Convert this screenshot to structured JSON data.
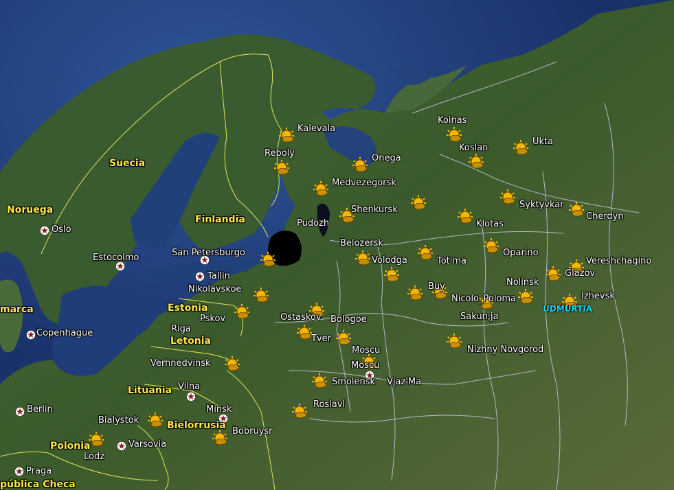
{
  "colors": {
    "sea": "#1f3f7a",
    "land": "#3c5a2a",
    "border": "#e6e65a",
    "region": "#c8c8e6",
    "icon": "#f5b800",
    "star": "#8a1a1a"
  },
  "countries": [
    {
      "id": "noruega",
      "label": "Noruega"
    },
    {
      "id": "suecia",
      "label": "Suecia"
    },
    {
      "id": "finlandia",
      "label": "Finlandia"
    },
    {
      "id": "estonia",
      "label": "Estonia"
    },
    {
      "id": "letonia",
      "label": "Letonia"
    },
    {
      "id": "lituania",
      "label": "Lituania"
    },
    {
      "id": "bielorrusia",
      "label": "Bielorrusia"
    },
    {
      "id": "polonia",
      "label": "Polonia"
    },
    {
      "id": "dinamarca",
      "label": "marca"
    },
    {
      "id": "chequia",
      "label": "pública Checa"
    }
  ],
  "region": {
    "label": "UDMURTIA"
  },
  "capitals": [
    {
      "id": "oslo",
      "label": "Oslo"
    },
    {
      "id": "estocolmo",
      "label": "Estocolmo"
    },
    {
      "id": "tallin",
      "label": "Tallin"
    },
    {
      "id": "copenhague",
      "label": "Copenhague"
    },
    {
      "id": "riga",
      "label": "Riga"
    },
    {
      "id": "vilna",
      "label": "Vilna"
    },
    {
      "id": "minsk",
      "label": "Minsk"
    },
    {
      "id": "berlin",
      "label": "Berlin"
    },
    {
      "id": "varsovia",
      "label": "Varsovia"
    },
    {
      "id": "praga",
      "label": "Praga"
    },
    {
      "id": "san-petersburgo",
      "label": "San Petersburgo"
    },
    {
      "id": "moscu",
      "label": "Moscu"
    }
  ],
  "stations": [
    {
      "id": "kalevala",
      "label": "Kalevala"
    },
    {
      "id": "reboly",
      "label": "Reboly"
    },
    {
      "id": "onega",
      "label": "Onega"
    },
    {
      "id": "medvezegorsk",
      "label": "Medvezegorsk"
    },
    {
      "id": "shenkursk",
      "label": "Shenkursk"
    },
    {
      "id": "pudozh",
      "label": "Pudozh"
    },
    {
      "id": "belozersk",
      "label": "Belozersk"
    },
    {
      "id": "volodga",
      "label": "Volodga"
    },
    {
      "id": "totma",
      "label": "Tot'ma"
    },
    {
      "id": "koinas",
      "label": "Koinas"
    },
    {
      "id": "koslan",
      "label": "Koslan"
    },
    {
      "id": "ukta",
      "label": "Ukta"
    },
    {
      "id": "syktyvkar",
      "label": "Syktyvkar"
    },
    {
      "id": "cherdyn",
      "label": "Cherdyn"
    },
    {
      "id": "klotas",
      "label": "Klotas"
    },
    {
      "id": "oparino",
      "label": "Oparino"
    },
    {
      "id": "vereshchagino",
      "label": "Vereshchagino"
    },
    {
      "id": "glazov",
      "label": "Glazov"
    },
    {
      "id": "nolinsk",
      "label": "Nolinsk"
    },
    {
      "id": "izhevsk",
      "label": "Izhevsk"
    },
    {
      "id": "buy",
      "label": "Buy"
    },
    {
      "id": "nicolo-poloma",
      "label": "Nicolo_Poloma"
    },
    {
      "id": "sakun",
      "label": "Sakun,ja"
    },
    {
      "id": "nizhny",
      "label": "Nizhny Novgorod"
    },
    {
      "id": "nikolavskoe",
      "label": "Nikolavskoe"
    },
    {
      "id": "pskov",
      "label": "Pskov"
    },
    {
      "id": "ostaskov",
      "label": "Ostaskov"
    },
    {
      "id": "bologoe",
      "label": "Bologoe"
    },
    {
      "id": "tver",
      "label": "Tver"
    },
    {
      "id": "moscu-st",
      "label": "Moscu"
    },
    {
      "id": "smolensk",
      "label": "Smolensk"
    },
    {
      "id": "vjazma",
      "label": "Vjaz'Ma"
    },
    {
      "id": "roslavl",
      "label": "Roslavl"
    },
    {
      "id": "verhnedvinsk",
      "label": "Verhnedvinsk"
    },
    {
      "id": "bialystok",
      "label": "Bialystok"
    },
    {
      "id": "bobruysr",
      "label": "Bobruysr"
    },
    {
      "id": "lodz",
      "label": "Lodz"
    }
  ]
}
